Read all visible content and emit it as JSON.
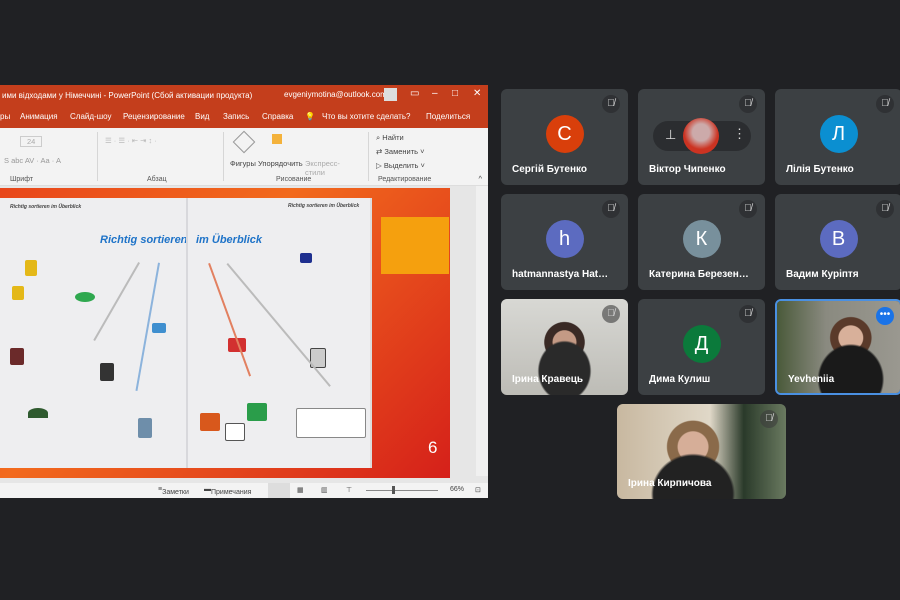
{
  "ppt": {
    "title": "ими відходами у Німеччині  -  PowerPoint (Сбой активации продукта)",
    "account": "evgeniymotina@outlook.com",
    "tabs": [
      "ры",
      "Анимация",
      "Слайд-шоу",
      "Рецензирование",
      "Вид",
      "Запись",
      "Справка"
    ],
    "tell_me": "Что вы хотите сделать?",
    "share": "Поделиться",
    "ribbon": {
      "font_size": "24",
      "shapes": "Фигуры",
      "arrange": "Упорядочить",
      "quick_styles": "Экспресс-стили",
      "find": "Найти",
      "replace": "Заменить",
      "select": "Выделить",
      "groups": [
        "Шрифт",
        "Абзац",
        "Рисование",
        "Редактирование"
      ]
    },
    "slide": {
      "number": "6",
      "photo_header_left": "Richtig sortieren im Überblick",
      "photo_header_right": "Richtig sortieren im Überblick",
      "photo_title_left": "Richtig sortieren",
      "photo_title_right": "im Überblick"
    },
    "status": {
      "notes": "Заметки",
      "comments": "Примечания",
      "zoom": "66%"
    }
  },
  "participants": [
    {
      "name": "Сергій Бутенко",
      "initial": "С",
      "color": "#d93f0b"
    },
    {
      "name": "Віктор Чипенко",
      "initial": "",
      "color": ""
    },
    {
      "name": "Лілія Бутенко",
      "initial": "Л",
      "color": "#0b8fd1"
    },
    {
      "name": "hatmannastya Hat…",
      "initial": "h",
      "color": "#5c6bc0"
    },
    {
      "name": "Катерина Березен…",
      "initial": "К",
      "color": "#78909c"
    },
    {
      "name": "Вадим Куріптя",
      "initial": "В",
      "color": "#5c6bc0"
    },
    {
      "name": "Ірина Кравець",
      "initial": "",
      "color": ""
    },
    {
      "name": "Дима Кулиш",
      "initial": "Д",
      "color": "#0b7a3b"
    },
    {
      "name": "Yevheniia",
      "initial": "",
      "color": ""
    },
    {
      "name": "Ірина Кирпичова",
      "initial": "",
      "color": ""
    }
  ]
}
